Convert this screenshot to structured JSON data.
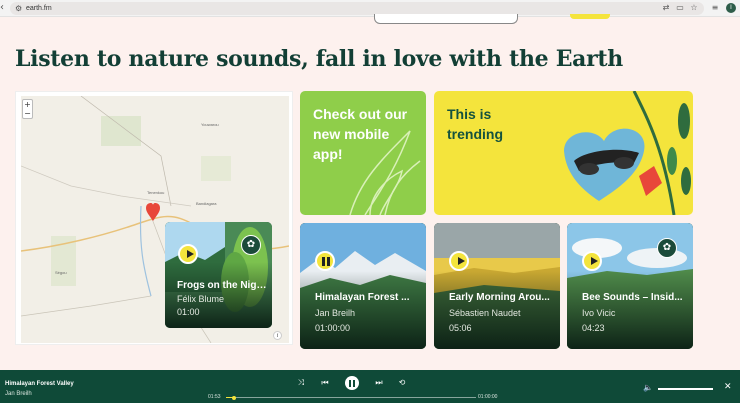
{
  "browser": {
    "url": "earth.fm",
    "profile_initial": "I"
  },
  "page": {
    "headline": "Listen to nature sounds, fall in love with the Earth"
  },
  "map": {
    "zoom_in": "+",
    "zoom_out": "−",
    "info": "i",
    "place_labels": [
      "Tenenkou",
      "Bandiagara",
      "Youwarou",
      "Ségou"
    ]
  },
  "promos": [
    {
      "title": "Check out our new mobile app!",
      "bg": "#8fce4a"
    },
    {
      "title": "This is trending",
      "bg": "#f4e43c"
    }
  ],
  "sounds": [
    {
      "title": "Frogs on the Niger ...",
      "author": "Félix Blume",
      "duration": "01:00",
      "state": "paused",
      "badge": true
    },
    {
      "title": "Himalayan Forest ...",
      "author": "Jan Breilh",
      "duration": "01:00:00",
      "state": "playing",
      "badge": false
    },
    {
      "title": "Early Morning Arou...",
      "author": "Sébastien Naudet",
      "duration": "05:06",
      "state": "paused",
      "badge": false
    },
    {
      "title": "Bee Sounds – Insid...",
      "author": "Ivo Vicic",
      "duration": "04:23",
      "state": "paused",
      "badge": true
    }
  ],
  "player": {
    "title": "Himalayan Forest Valley",
    "author": "Jan Breilh",
    "elapsed": "01:53",
    "total": "01:00:00",
    "progress": 0.032,
    "volume": 1.0
  },
  "colors": {
    "accent": "#f4e43c",
    "brand_dark": "#0f4a38",
    "headline": "#123f35",
    "background": "#fdf1ee"
  }
}
